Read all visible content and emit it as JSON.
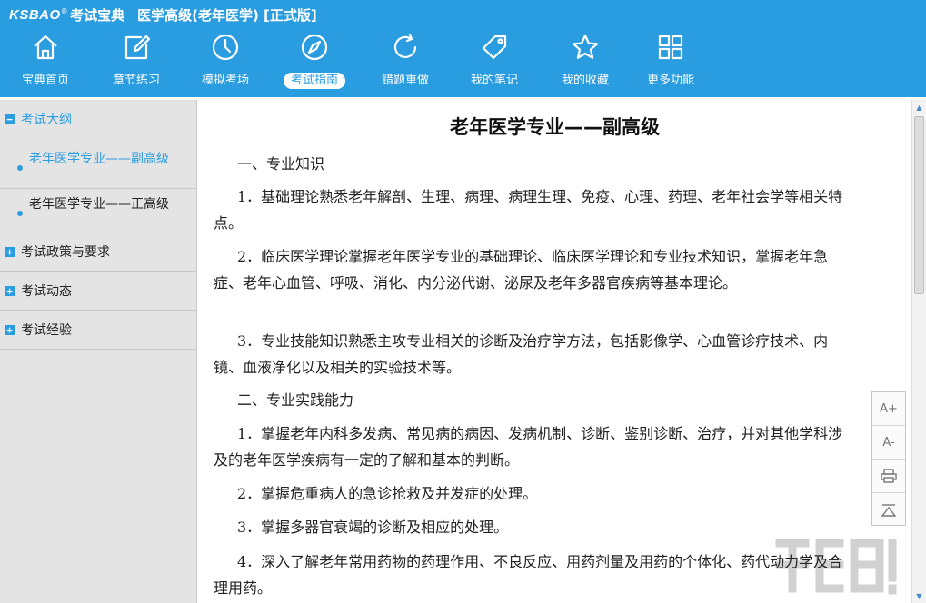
{
  "header": {
    "logo": "KSBAO",
    "logo_reg": "®",
    "brand": "考试宝典",
    "app_title": "医学高级(老年医学) [正式版]"
  },
  "nav": [
    {
      "label": "宝典首页",
      "icon": "home-icon"
    },
    {
      "label": "章节练习",
      "icon": "edit-icon"
    },
    {
      "label": "模拟考场",
      "icon": "clock-icon"
    },
    {
      "label": "考试指南",
      "icon": "compass-icon",
      "active": true
    },
    {
      "label": "错题重做",
      "icon": "refresh-icon"
    },
    {
      "label": "我的笔记",
      "icon": "tag-icon"
    },
    {
      "label": "我的收藏",
      "icon": "star-icon"
    },
    {
      "label": "更多功能",
      "icon": "grid-icon"
    }
  ],
  "sidebar": {
    "sections": [
      {
        "label": "考试大纲",
        "toggle": "−",
        "items": [
          {
            "label": "老年医学专业——副高级",
            "selected": true
          },
          {
            "label": "老年医学专业——正高级"
          }
        ]
      },
      {
        "label": "考试政策与要求",
        "toggle": "+"
      },
      {
        "label": "考试动态",
        "toggle": "+"
      },
      {
        "label": "考试经验",
        "toggle": "+"
      }
    ]
  },
  "document": {
    "title": "老年医学专业——副高级",
    "heading1": "一、专业知识",
    "p1": "1．基础理论熟悉老年解剖、生理、病理、病理生理、免疫、心理、药理、老年社会学等相关特点。",
    "p2": "2．临床医学理论掌握老年医学专业的基础理论、临床医学理论和专业技术知识，掌握老年急症、老年心血管、呼吸、消化、内分泌代谢、泌尿及老年多器官疾病等基本理论。",
    "p3": "3．专业技能知识熟悉主攻专业相关的诊断及治疗学方法，包括影像学、心血管诊疗技术、内镜、血液净化以及相关的实验技术等。",
    "heading2": "二、专业实践能力",
    "p4": "1．掌握老年内科多发病、常见病的病因、发病机制、诊断、鉴别诊断、治疗，并对其他学科涉及的老年医学疾病有一定的了解和基本的判断。",
    "p5": "2．掌握危重病人的急诊抢救及并发症的处理。",
    "p6": "3．掌握多器官衰竭的诊断及相应的处理。",
    "p7": "4．深入了解老年常用药物的药理作用、不良反应、用药剂量及用药的个体化、药代动力学及合理用药。"
  },
  "tools": {
    "font_up": "A+",
    "font_down": "A-"
  },
  "colors": {
    "header": "#2a9ce0",
    "accent": "#2a9ce0",
    "sidebar": "#e4e4e4"
  }
}
